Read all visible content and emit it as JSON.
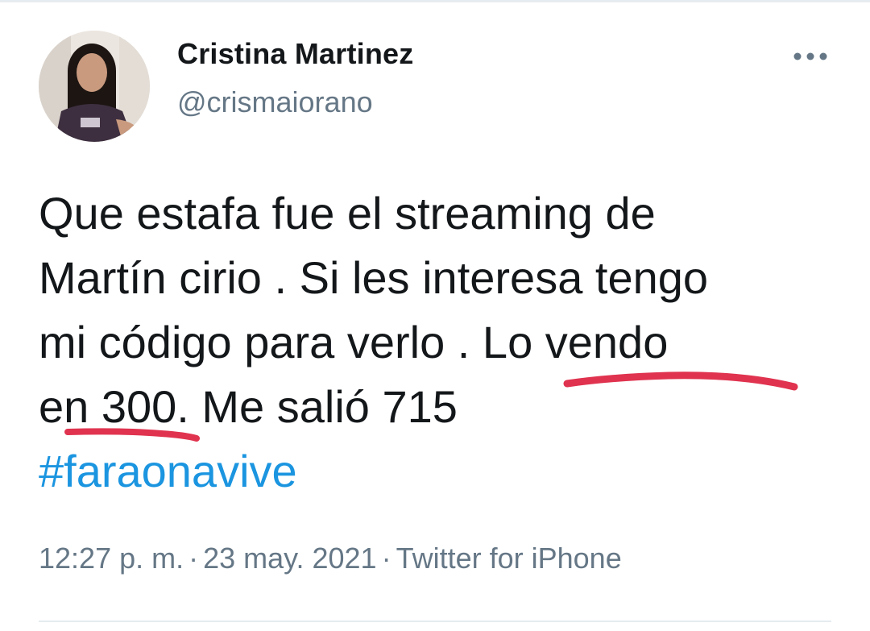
{
  "tweet": {
    "author": {
      "display_name": "Cristina Martinez",
      "handle": "@crismaiorano"
    },
    "body_lines": [
      "Que estafa fue el streaming de",
      "Martín cirio . Si les interesa tengo",
      "mi código para verlo . Lo vendo",
      "en 300. Me salió 715"
    ],
    "hashtag": "#faraonavive",
    "time": "12:27 p. m.",
    "separator": "·",
    "date": "23 may. 2021",
    "source": "Twitter for iPhone"
  },
  "colors": {
    "text": "#14171a",
    "secondary": "#657786",
    "link": "#1b95e0",
    "annotation": "#e0334f",
    "divider": "#e6ecf0"
  },
  "icons": {
    "more": "more-horizontal-icon"
  }
}
